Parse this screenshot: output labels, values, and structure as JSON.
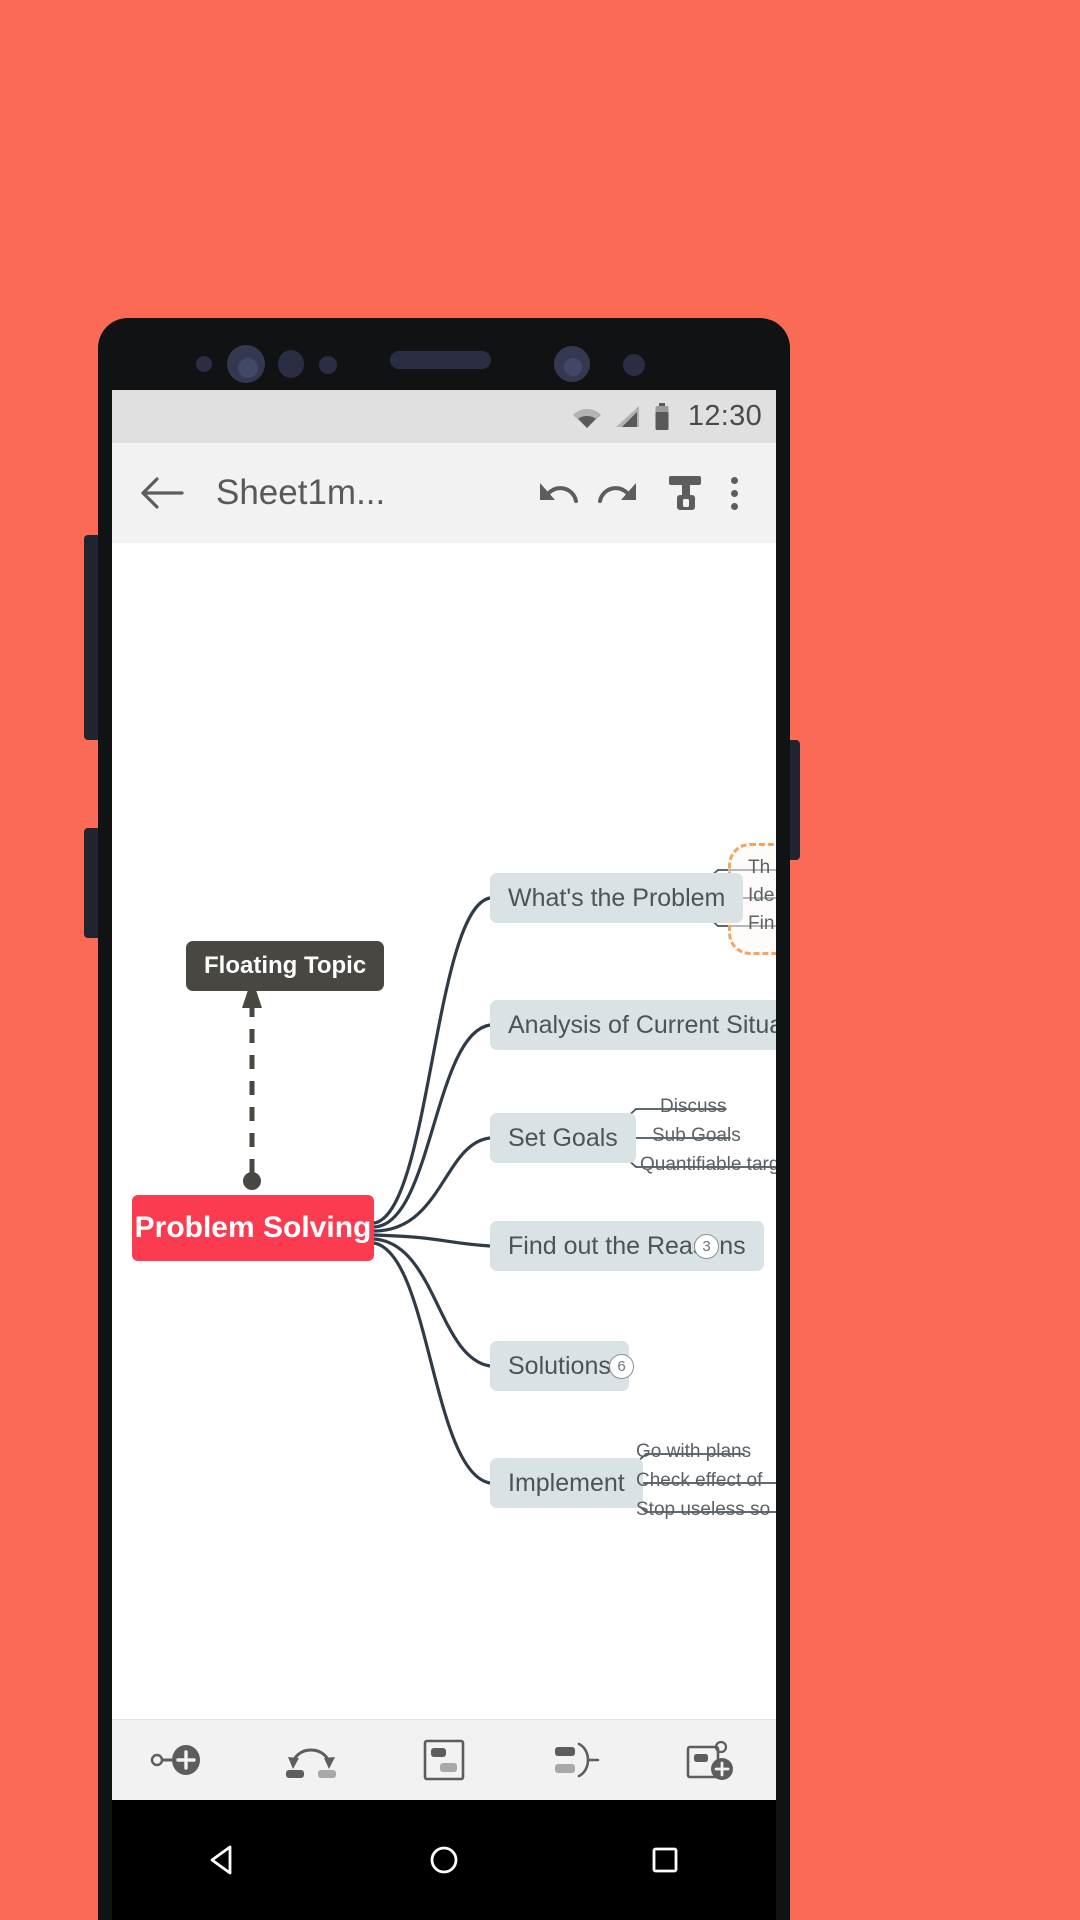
{
  "theme": {
    "page_background": "#fb6a54",
    "phone_body": "#111214",
    "status_bar_bg": "#e0e0e0",
    "app_bar_bg": "#f2f2f2",
    "canvas_bg": "#ffffff",
    "root_node_color": "#fb3b50",
    "floating_node_color": "#484741",
    "branch_node_color": "#d9e2e4",
    "boundary_color": "#f7a35c",
    "line_color": "#2f3b47"
  },
  "status_bar": {
    "time": "12:30",
    "icons": [
      "wifi-icon",
      "cellular-signal-icon",
      "battery-icon"
    ]
  },
  "app_bar": {
    "back_icon": "arrow-left-icon",
    "title": "Sheet1m...",
    "undo_icon": "undo-icon",
    "redo_icon": "redo-icon",
    "format_icon": "format-brush-icon",
    "overflow_icon": "more-vertical-icon"
  },
  "mindmap": {
    "root": {
      "label": "Problem Solving"
    },
    "floating_topic": {
      "label": "Floating Topic"
    },
    "branches": [
      {
        "label": "What's the Problem",
        "children": [
          "Th",
          "Ide",
          "Fin"
        ],
        "boundary": true
      },
      {
        "label": "Analysis of Current Situation",
        "children": []
      },
      {
        "label": "Set Goals",
        "children": [
          "Discuss",
          "Sub Goals",
          "Quantifiable targe"
        ]
      },
      {
        "label": "Find out the Reasons",
        "badge": "3",
        "children": []
      },
      {
        "label": "Solutions",
        "badge": "6",
        "children": []
      },
      {
        "label": "Implement",
        "children": [
          "Go with plans",
          "Check effect of",
          "Stop useless so"
        ]
      }
    ]
  },
  "bottom_toolbar": {
    "items": [
      {
        "name": "add-sibling-topic-button",
        "icon": "node-plus-icon"
      },
      {
        "name": "add-relationship-button",
        "icon": "relationship-arrow-icon"
      },
      {
        "name": "insert-frame-button",
        "icon": "frame-box-icon"
      },
      {
        "name": "add-boundary-button",
        "icon": "boundary-brace-icon"
      },
      {
        "name": "add-floating-topic-button",
        "icon": "floating-topic-plus-icon"
      }
    ]
  },
  "nav_bar": {
    "back": "nav-back-triangle-icon",
    "home": "nav-home-circle-icon",
    "recents": "nav-recents-square-icon"
  }
}
